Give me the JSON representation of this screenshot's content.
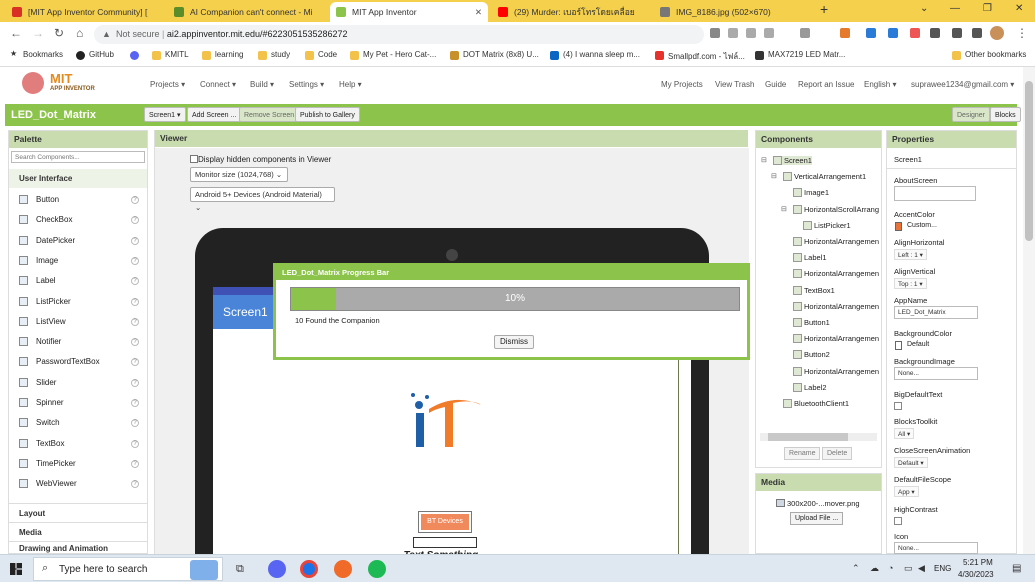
{
  "browser": {
    "tabs": [
      {
        "title": "[MIT App Inventor Community] [",
        "color": "#d93025"
      },
      {
        "title": "AI Companion can't connect - Mi",
        "color": "#5b8c2a"
      },
      {
        "title": "MIT App Inventor",
        "color": "#8cc34a"
      },
      {
        "title": "(29) Murder: เบอร์โทรโดยเคลื่อย",
        "color": "#ff0000"
      },
      {
        "title": "IMG_8186.jpg (502×670)",
        "color": "#777777"
      }
    ],
    "new_tab": "+",
    "not_secure": "Not secure",
    "url": "ai2.appinventor.mit.edu/#6223051535286272",
    "bookmarks": [
      "Bookmarks",
      "GitHub",
      "KMITL",
      "learning",
      "study",
      "Code",
      "My Pet - Hero Cat-...",
      "DOT Matrix (8x8) U...",
      "(4) I wanna sleep m...",
      "Smallpdf.com - ไฟล์...",
      "MAX7219 LED Matr..."
    ],
    "other_bookmarks": "Other bookmarks"
  },
  "app": {
    "logo_top": "MIT",
    "logo_bottom": "APP INVENTOR",
    "menus": [
      "Projects ▾",
      "Connect ▾",
      "Build ▾",
      "Settings ▾",
      "Help ▾"
    ],
    "right_links": [
      "My Projects",
      "View Trash",
      "Guide",
      "Report an Issue",
      "English ▾",
      "suprawee1234@gmail.com ▾"
    ],
    "project_title": "LED_Dot_Matrix",
    "toolbar": {
      "screen": "Screen1 ▾",
      "add": "Add Screen ...",
      "remove": "Remove Screen",
      "publish": "Publish to Gallery",
      "designer": "Designer",
      "blocks": "Blocks"
    }
  },
  "palette": {
    "title": "Palette",
    "search_placeholder": "Search Components...",
    "category": "User Interface",
    "items": [
      "Button",
      "CheckBox",
      "DatePicker",
      "Image",
      "Label",
      "ListPicker",
      "ListView",
      "Notifier",
      "PasswordTextBox",
      "Slider",
      "Spinner",
      "Switch",
      "TextBox",
      "TimePicker",
      "WebViewer"
    ],
    "more_categories": [
      "Layout",
      "Media",
      "Drawing and Animation"
    ]
  },
  "viewer": {
    "title": "Viewer",
    "hidden_label": "Display hidden components in Viewer",
    "monitor": "Monitor size (1024,768)",
    "device": "Android 5+ Devices (Android Material)",
    "screen_title": "Screen1",
    "bt_button": "BT Devices",
    "text_label": "Text Something..."
  },
  "dialog": {
    "title": "LED_Dot_Matrix Progress Bar",
    "progress": 10,
    "progress_text": "10%",
    "status": "10 Found the Companion",
    "dismiss": "Dismiss"
  },
  "components": {
    "title": "Components",
    "tree": [
      {
        "name": "Screen1",
        "level": 0,
        "toggle": "⊟"
      },
      {
        "name": "VerticalArrangement1",
        "level": 1,
        "toggle": "⊟"
      },
      {
        "name": "Image1",
        "level": 2,
        "toggle": ""
      },
      {
        "name": "HorizontalScrollArrang",
        "level": 2,
        "toggle": "⊟"
      },
      {
        "name": "ListPicker1",
        "level": 3,
        "toggle": ""
      },
      {
        "name": "HorizontalArrangemen",
        "level": 2,
        "toggle": ""
      },
      {
        "name": "Label1",
        "level": 2,
        "toggle": ""
      },
      {
        "name": "HorizontalArrangemen",
        "level": 2,
        "toggle": ""
      },
      {
        "name": "TextBox1",
        "level": 2,
        "toggle": ""
      },
      {
        "name": "HorizontalArrangemen",
        "level": 2,
        "toggle": ""
      },
      {
        "name": "Button1",
        "level": 2,
        "toggle": ""
      },
      {
        "name": "HorizontalArrangemen",
        "level": 2,
        "toggle": ""
      },
      {
        "name": "Button2",
        "level": 2,
        "toggle": ""
      },
      {
        "name": "HorizontalArrangemen",
        "level": 2,
        "toggle": ""
      },
      {
        "name": "Label2",
        "level": 2,
        "toggle": ""
      },
      {
        "name": "BluetoothClient1",
        "level": 1,
        "toggle": ""
      }
    ],
    "rename": "Rename",
    "delete": "Delete"
  },
  "media": {
    "title": "Media",
    "file": "300x200-...mover.png",
    "upload": "Upload File ..."
  },
  "properties": {
    "title": "Properties",
    "component": "Screen1",
    "accent_color": "#e8743b",
    "items": {
      "about_screen": "AboutScreen",
      "accent": "AccentColor",
      "accent_value": "Custom...",
      "align_h": "AlignHorizontal",
      "align_h_value": "Left : 1 ▾",
      "align_v": "AlignVertical",
      "align_v_value": "Top : 1 ▾",
      "app_name": "AppName",
      "app_name_value": "LED_Dot_Matrix",
      "bg_color": "BackgroundColor",
      "bg_color_value": "Default",
      "bg_image": "BackgroundImage",
      "bg_image_value": "None...",
      "big_text": "BigDefaultText",
      "blocks_toolkit": "BlocksToolkit",
      "blocks_toolkit_value": "All ▾",
      "close_anim": "CloseScreenAnimation",
      "close_anim_value": "Default ▾",
      "file_scope": "DefaultFileScope",
      "file_scope_value": "App ▾",
      "high_contrast": "HighContrast",
      "icon": "Icon",
      "icon_value": "None..."
    }
  },
  "taskbar": {
    "search": "Type here to search",
    "lang": "ENG",
    "time": "5:21 PM",
    "date": "4/30/2023"
  }
}
